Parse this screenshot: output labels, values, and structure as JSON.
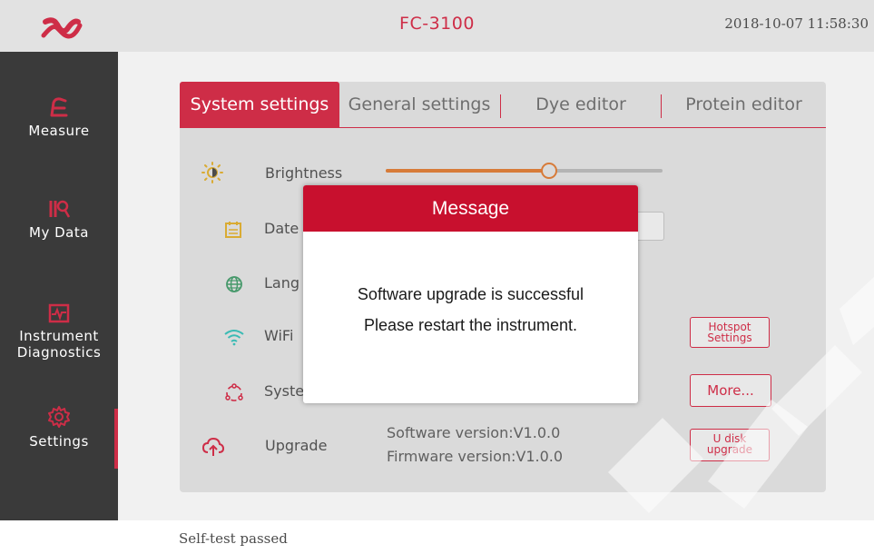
{
  "header": {
    "device_name": "FC-3100",
    "datetime": "2018-10-07  11:58:30",
    "logo_icon": "brand-logo-icon"
  },
  "sidebar": {
    "items": [
      {
        "label": "Measure",
        "icon": "measure-icon"
      },
      {
        "label": "My Data",
        "icon": "my-data-icon"
      },
      {
        "label_line1": "Instrument",
        "label_line2": "Diagnostics",
        "icon": "diagnostics-icon"
      },
      {
        "label": "Settings",
        "icon": "settings-gear-icon",
        "active": true
      }
    ]
  },
  "tabs": [
    {
      "label": "System settings",
      "active": true
    },
    {
      "label": "General settings",
      "active": false
    },
    {
      "label": "Dye editor",
      "active": false
    },
    {
      "label": "Protein editor",
      "active": false
    }
  ],
  "settings": {
    "brightness": {
      "label": "Brightness",
      "value_fraction": 0.59,
      "icon": "brightness-icon"
    },
    "date": {
      "label": "Date",
      "icon": "calendar-icon"
    },
    "language": {
      "label": "Lang",
      "icon": "globe-icon"
    },
    "wifi": {
      "label": "WiFi",
      "icon": "wifi-icon",
      "button": "Hotspot Settings",
      "button_line1": "Hotspot",
      "button_line2": "Settings"
    },
    "system": {
      "label": "Syste",
      "icon": "system-icon",
      "button": "More..."
    },
    "upgrade": {
      "label": "Upgrade",
      "icon": "upgrade-cloud-icon",
      "software_version": "Software version:V1.0.0",
      "firmware_version": "Firmware version:V1.0.0",
      "button_line1": "U disk",
      "button_line2": "upgrade"
    }
  },
  "dialog": {
    "title": "Message",
    "line1": "Software upgrade is successful",
    "line2": "Please restart the instrument."
  },
  "status": {
    "text": "Self-test passed"
  },
  "colors": {
    "accent": "#c8102e",
    "slider": "#d2691e",
    "sidebar_bg": "#1f1f1f",
    "topbar_bg": "#dedede"
  }
}
